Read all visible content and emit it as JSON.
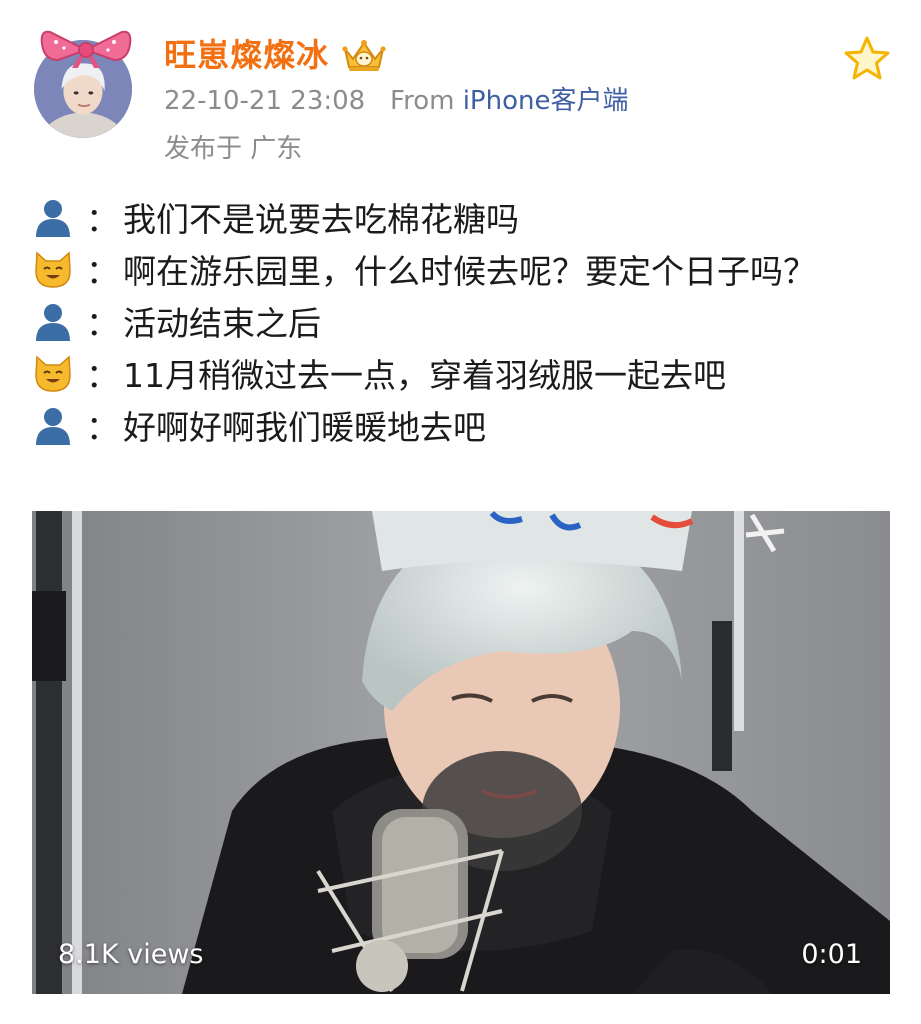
{
  "post": {
    "username": "旺崽燦燦冰",
    "timestamp": "22-10-21 23:08",
    "source_prefix": "From",
    "source_app": "iPhone客户端",
    "location": "发布于 广东",
    "colors": {
      "username": "#f27012",
      "meta": "#8c8c8c",
      "source_app": "#3f5fa3",
      "star": "#f5b400"
    },
    "icons": {
      "crown": "crown-badge-icon",
      "favorite": "star-outline-icon",
      "speaker_a": "bust-in-silhouette-emoji",
      "speaker_b": "smiling-cat-emoji"
    }
  },
  "content": {
    "lines": [
      {
        "speaker": "person",
        "text": "我们不是说要去吃棉花糖吗"
      },
      {
        "speaker": "cat",
        "text": "啊在游乐园里，什么时候去呢？要定个日子吗？"
      },
      {
        "speaker": "person",
        "text": "活动结束之后"
      },
      {
        "speaker": "cat",
        "text": "11月稍微过去一点，穿着羽绒服一起去吧"
      },
      {
        "speaker": "person",
        "text": "好啊好啊我们暖暖地去吧"
      }
    ],
    "colon": "："
  },
  "video": {
    "views": "8.1K views",
    "duration": "0:01"
  }
}
